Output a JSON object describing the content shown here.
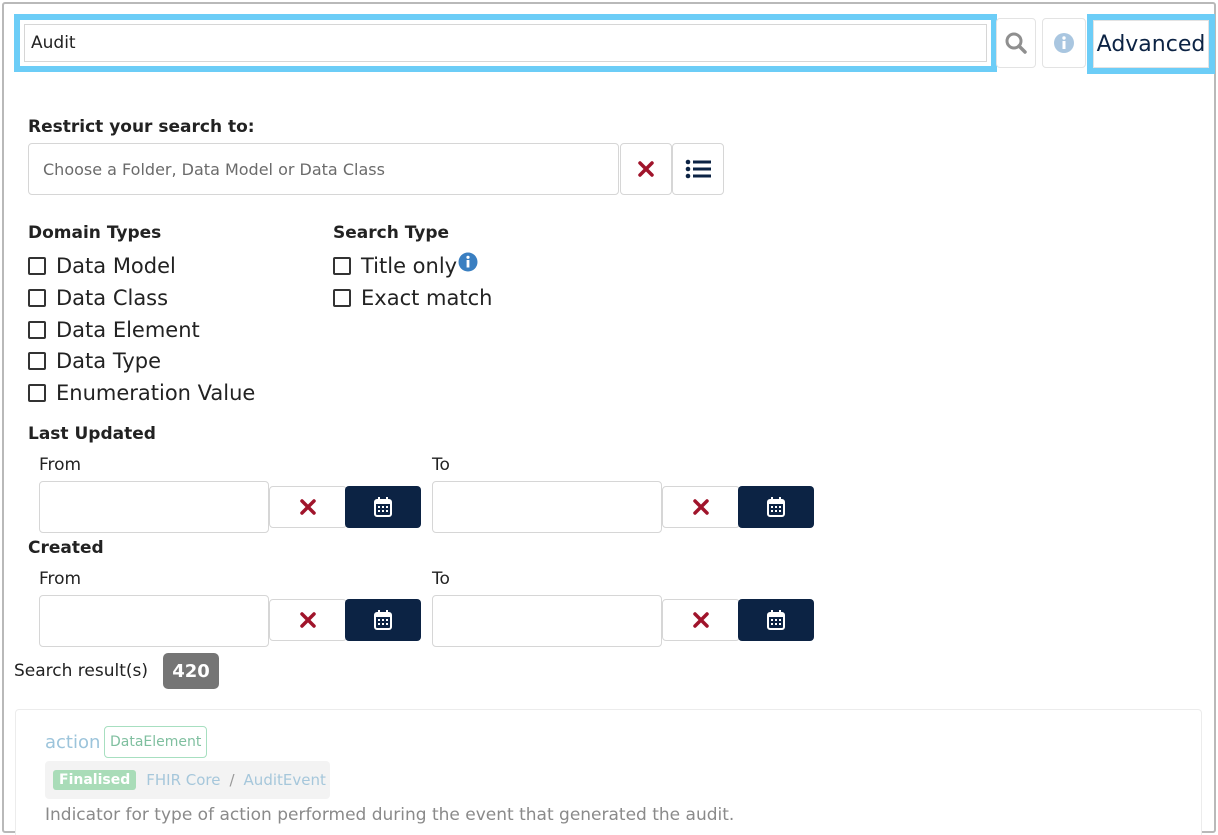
{
  "search": {
    "value": "Audit",
    "advanced_label": "Advanced"
  },
  "restrict": {
    "label": "Restrict your search to:",
    "placeholder": "Choose a Folder, Data Model or Data Class"
  },
  "domain_types": {
    "label": "Domain Types",
    "items": [
      "Data Model",
      "Data Class",
      "Data Element",
      "Data Type",
      "Enumeration Value"
    ]
  },
  "search_type": {
    "label": "Search Type",
    "items": [
      "Title only",
      "Exact match"
    ]
  },
  "last_updated": {
    "label": "Last Updated",
    "from_label": "From",
    "to_label": "To"
  },
  "created": {
    "label": "Created",
    "from_label": "From",
    "to_label": "To"
  },
  "results": {
    "label": "Search result(s)",
    "count": "420",
    "items": [
      {
        "title": "action",
        "type": "DataElement",
        "status": "Finalised",
        "path": [
          "FHIR Core",
          "AuditEvent"
        ],
        "path_sep": "/",
        "description": "Indicator for type of action performed during the event that generated the audit."
      }
    ]
  },
  "colors": {
    "accent_outline": "#6ccdf7",
    "navy": "#0c2344",
    "clear_red": "#a0142b",
    "info_blue": "#3a7fc1"
  },
  "icons": [
    "search-icon",
    "info-icon",
    "close-icon",
    "list-icon",
    "calendar-icon"
  ]
}
